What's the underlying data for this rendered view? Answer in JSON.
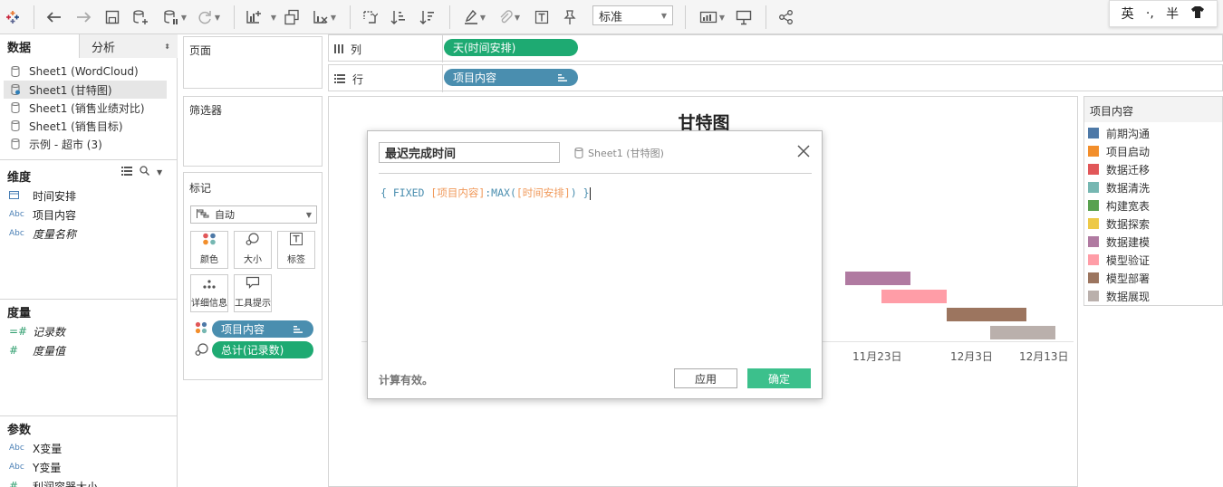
{
  "toolbar": {
    "fit_value": "标准",
    "ime": {
      "lang": "英",
      "punct": "·,",
      "width": "半"
    }
  },
  "data_pane": {
    "tabs": {
      "data": "数据",
      "analysis": "分析"
    },
    "sources": [
      {
        "label": "Sheet1 (WordCloud)"
      },
      {
        "label": "Sheet1 (甘特图)"
      },
      {
        "label": "Sheet1 (销售业绩对比)"
      },
      {
        "label": "Sheet1 (销售目标)"
      },
      {
        "label": "示例 - 超市 (3)"
      }
    ],
    "dimensions_title": "维度",
    "dimensions": [
      {
        "type": "date",
        "label": "时间安排"
      },
      {
        "type": "Abc",
        "label": "项目内容"
      },
      {
        "type": "Abc",
        "label": "度量名称"
      }
    ],
    "measures_title": "度量",
    "measures": [
      {
        "type": "=#",
        "label": "记录数"
      },
      {
        "type": "#",
        "label": "度量值"
      }
    ],
    "params_title": "参数",
    "params": [
      {
        "type": "Abc",
        "label": "X变量"
      },
      {
        "type": "Abc",
        "label": "Y变量"
      },
      {
        "type": "#",
        "label": "利润容器大小"
      }
    ]
  },
  "cards": {
    "pages_title": "页面",
    "filters_title": "筛选器",
    "marks_title": "标记",
    "marks_type": "自动",
    "mark_buttons": {
      "color": "颜色",
      "size": "大小",
      "label": "标签",
      "detail": "详细信息",
      "tooltip": "工具提示"
    },
    "mark_pills": {
      "color_field": "项目内容",
      "size_field": "总计(记录数)"
    }
  },
  "shelves": {
    "columns_label": "列",
    "columns_pill": "天(时间安排)",
    "rows_label": "行",
    "rows_pill": "项目内容"
  },
  "chart": {
    "title": "甘特图",
    "x_ticks": [
      "11月23日",
      "12月3日",
      "12月13日"
    ]
  },
  "chart_data": {
    "type": "bar",
    "title": "甘特图",
    "subtype": "gantt",
    "x_tick_labels": [
      "11月23日",
      "12月3日",
      "12月13日"
    ],
    "visible_bars": [
      {
        "category": "数据建模",
        "start": "11月19日",
        "end": "11月28日"
      },
      {
        "category": "模型验证",
        "start": "11月24日",
        "end": "12月3日"
      },
      {
        "category": "模型部署",
        "start": "12月3日",
        "end": "12月14日"
      },
      {
        "category": "数据展现",
        "start": "12月9日",
        "end": "12月18日"
      }
    ]
  },
  "legend": {
    "title": "项目内容",
    "items": [
      {
        "label": "前期沟通",
        "color": "#4e79a7"
      },
      {
        "label": "项目启动",
        "color": "#f28e2b"
      },
      {
        "label": "数据迁移",
        "color": "#e15759"
      },
      {
        "label": "数据清洗",
        "color": "#76b7b2"
      },
      {
        "label": "构建宽表",
        "color": "#59a14f"
      },
      {
        "label": "数据探索",
        "color": "#edc948"
      },
      {
        "label": "数据建模",
        "color": "#b07aa1"
      },
      {
        "label": "模型验证",
        "color": "#ff9da7"
      },
      {
        "label": "模型部署",
        "color": "#9c755f"
      },
      {
        "label": "数据展现",
        "color": "#bab0ac"
      }
    ]
  },
  "dialog": {
    "calc_name": "最迟完成时间",
    "source": "Sheet1 (甘特图)",
    "formula": {
      "open": "{ FIXED ",
      "field1": "[项目内容]",
      "mid": ":MAX(",
      "field2": "[时间安排]",
      "close": ") }"
    },
    "status": "计算有效。",
    "apply": "应用",
    "ok": "确定"
  }
}
